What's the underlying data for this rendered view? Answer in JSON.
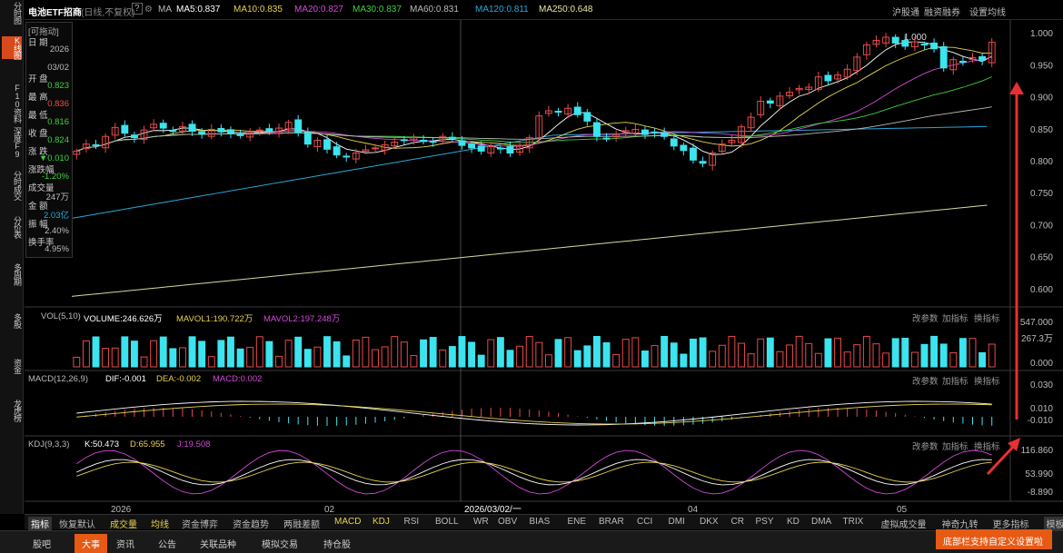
{
  "left_nav": [
    "分时图",
    "K线图",
    "F10资料",
    "深度F9",
    "分时成交",
    "分价表",
    "多周期",
    "多股",
    "资金",
    "龙虎榜"
  ],
  "header": {
    "title": "电池ETF招商",
    "mode": "(日线,不复权)",
    "help": "?",
    "ma_label": "MA",
    "ma5": "MA5:0.837",
    "ma10": "MA10:0.835",
    "ma20": "MA20:0.827",
    "ma30": "MA30:0.837",
    "ma60": "MA60:0.831",
    "ma120": "MA120:0.811",
    "ma250": "MA250:0.648",
    "right": [
      "沪股通",
      "融资融券",
      "设置均线"
    ]
  },
  "info_panel": {
    "title": "[可拖动]",
    "rows": [
      {
        "label": "日 期",
        "value": "2026"
      },
      {
        "label": "",
        "value": "03/02"
      },
      {
        "label": "开 盘",
        "value": "0.823"
      },
      {
        "label": "最 高",
        "value": "0.836"
      },
      {
        "label": "最 低",
        "value": "0.816"
      },
      {
        "label": "收 盘",
        "value": "0.824"
      },
      {
        "label": "涨 跌",
        "value": "▼0.010"
      },
      {
        "label": "涨跌幅",
        "value": "-1.20%"
      },
      {
        "label": "成交量",
        "value": "247万"
      },
      {
        "label": "金 额",
        "value": "2.03亿"
      },
      {
        "label": "振 幅",
        "value": "2.40%"
      },
      {
        "label": "换手率",
        "value": "4.95%"
      }
    ]
  },
  "price_axis": [
    "1.000",
    "0.950",
    "0.900",
    "0.850",
    "0.800",
    "0.750",
    "0.700",
    "0.650",
    "0.600"
  ],
  "peak_label": "← 1.000",
  "volume": {
    "label": "VOL(5,10)",
    "volume": "VOLUME:246.626万",
    "mavol1": "MAVOL1:190.722万",
    "mavol2": "MAVOL2:197.248万",
    "axis": [
      "547.000",
      "267.3万",
      "0.000"
    ]
  },
  "macd": {
    "label": "MACD(12,26,9)",
    "dif": "DIF:-0.001",
    "dea": "DEA:-0.002",
    "macd": "MACD:0.002",
    "axis": [
      "0.030",
      "0.010",
      "-0.010"
    ]
  },
  "kdj": {
    "label": "KDJ(9,3,3)",
    "k": "K:50.473",
    "d": "D:65.955",
    "j": "J:19.508",
    "axis": [
      "116.860",
      "53.990",
      "-8.890"
    ]
  },
  "pane_actions": [
    "改参数",
    "加指标",
    "换指标"
  ],
  "x_axis": [
    "2026",
    "02",
    "2026/03/02/一",
    "04",
    "05"
  ],
  "indicator_tabs": [
    "指标",
    "恢复默认",
    "成交量",
    "均线",
    "资金博弈",
    "资金趋势",
    "两融差额",
    "MACD",
    "KDJ",
    "RSI",
    "BOLL",
    "WR",
    "OBV",
    "BIAS",
    "ENE",
    "BRAR",
    "CCI",
    "DMI",
    "DKX",
    "CR",
    "PSY",
    "KD",
    "DMA",
    "TRIX",
    "虚拟成交量",
    "神奇九转",
    "更多指标",
    "模板"
  ],
  "footer_tabs": [
    "股吧",
    "大事",
    "资讯",
    "公告",
    "关联品种",
    "模拟交易",
    "持仓股"
  ],
  "toast": "底部栏支持自定义设置啦",
  "chart_data": {
    "type": "candlestick",
    "ylim": [
      0.58,
      1.02
    ],
    "closes": [
      0.815,
      0.826,
      0.824,
      0.838,
      0.852,
      0.843,
      0.836,
      0.848,
      0.857,
      0.851,
      0.847,
      0.853,
      0.846,
      0.842,
      0.849,
      0.845,
      0.843,
      0.84,
      0.844,
      0.848,
      0.846,
      0.851,
      0.86,
      0.844,
      0.826,
      0.832,
      0.818,
      0.809,
      0.806,
      0.812,
      0.817,
      0.82,
      0.825,
      0.829,
      0.832,
      0.836,
      0.83,
      0.829,
      0.838,
      0.835,
      0.824,
      0.82,
      0.815,
      0.822,
      0.819,
      0.812,
      0.824,
      0.836,
      0.87,
      0.878,
      0.877,
      0.882,
      0.872,
      0.862,
      0.838,
      0.834,
      0.841,
      0.847,
      0.849,
      0.841,
      0.844,
      0.838,
      0.823,
      0.816,
      0.801,
      0.796,
      0.812,
      0.826,
      0.832,
      0.853,
      0.868,
      0.893,
      0.89,
      0.901,
      0.907,
      0.913,
      0.915,
      0.931,
      0.925,
      0.934,
      0.943,
      0.962,
      0.981,
      0.988,
      0.993,
      0.984,
      0.979,
      0.986,
      0.982,
      0.975,
      0.945,
      0.958,
      0.955,
      0.961,
      0.957,
      0.985
    ]
  }
}
